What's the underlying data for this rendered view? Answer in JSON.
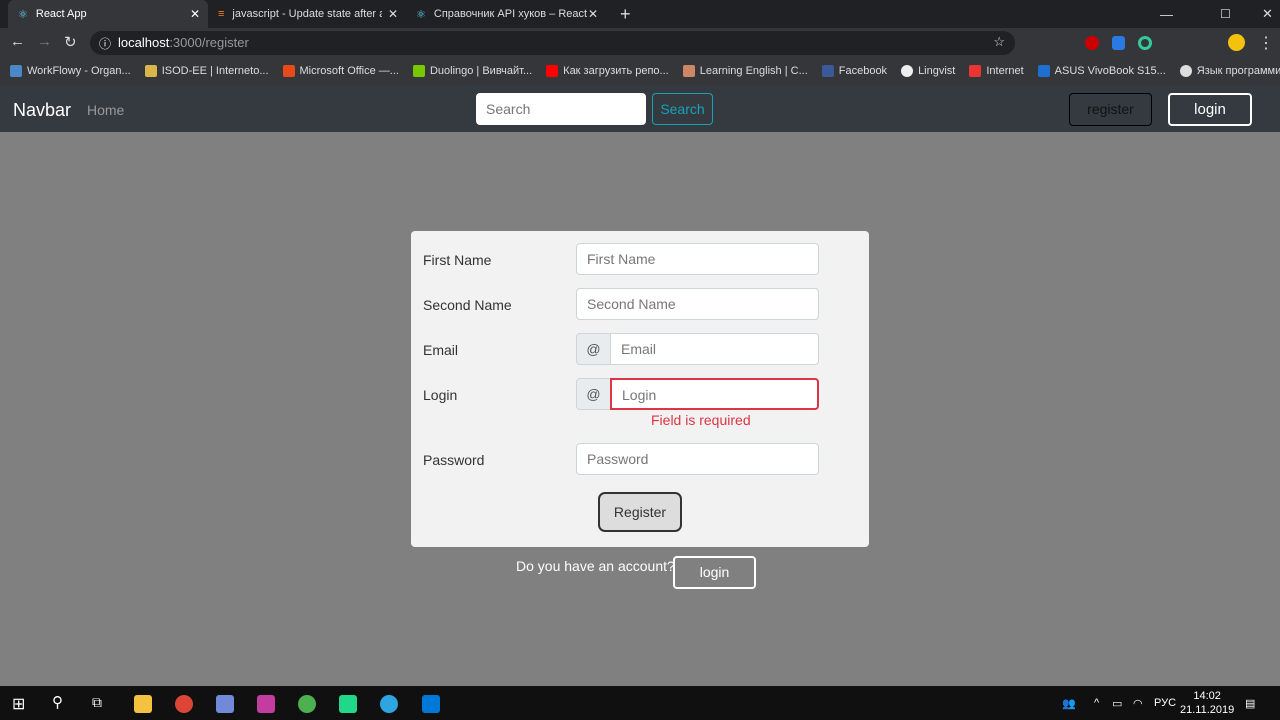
{
  "browser": {
    "tabs": [
      {
        "title": "React App"
      },
      {
        "title": "javascript - Update state after axi"
      },
      {
        "title": "Справочник API хуков – React"
      }
    ],
    "url_host": "localhost",
    "url_path": ":3000/register",
    "bookmarks": [
      "WorkFlowy - Organ...",
      "ISOD-EE | Interneto...",
      "Microsoft Office —...",
      "Duolingo | Вивчайт...",
      "Как загрузить репо...",
      "Learning English | C...",
      "Facebook",
      "Lingvist",
      "Internet",
      "ASUS VivoBook S15...",
      "Язык программир..."
    ]
  },
  "navbar": {
    "brand": "Navbar",
    "home": "Home",
    "search_placeholder": "Search",
    "search_button": "Search",
    "register": "register",
    "login": "login"
  },
  "form": {
    "first_name_label": "First Name",
    "first_name_placeholder": "First Name",
    "second_name_label": "Second Name",
    "second_name_placeholder": "Second Name",
    "email_label": "Email",
    "email_prefix": "@",
    "email_placeholder": "Email",
    "login_label": "Login",
    "login_prefix": "@",
    "login_placeholder": "Login",
    "login_error": "Field is required",
    "password_label": "Password",
    "password_placeholder": "Password",
    "register_button": "Register"
  },
  "footer": {
    "question": "Do you have an account?",
    "login_button": "login"
  },
  "taskbar": {
    "lang": "РУС",
    "time": "14:02",
    "date": "21.11.2019"
  }
}
